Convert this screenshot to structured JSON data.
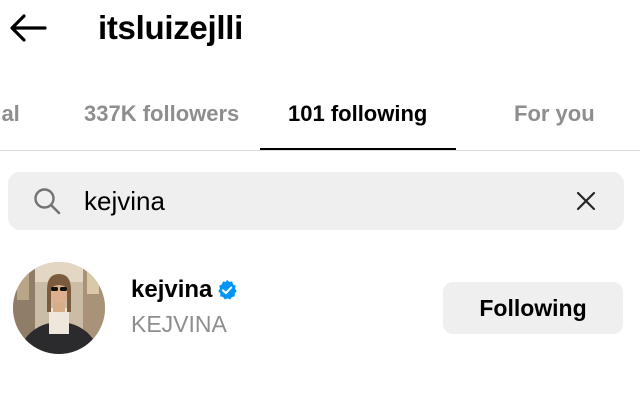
{
  "header": {
    "back_icon": "arrow-left-icon",
    "username": "itsluizejlli"
  },
  "tabs": [
    {
      "label": "Mutual",
      "visible_text": "ual",
      "active": false
    },
    {
      "label": "337K followers",
      "active": false
    },
    {
      "label": "101 following",
      "active": true
    },
    {
      "label": "For you",
      "active": false
    }
  ],
  "search": {
    "icon": "search-icon",
    "value": "kejvina",
    "clear_icon": "close-icon"
  },
  "results": [
    {
      "username": "kejvina",
      "verified": true,
      "full_name": "KEJVINA",
      "button_label": "Following"
    }
  ],
  "colors": {
    "muted_text": "#8e8e8e",
    "search_bg": "#efefef",
    "button_bg": "#efefef",
    "verified_blue": "#0095f6",
    "divider": "#dbdbdb"
  }
}
